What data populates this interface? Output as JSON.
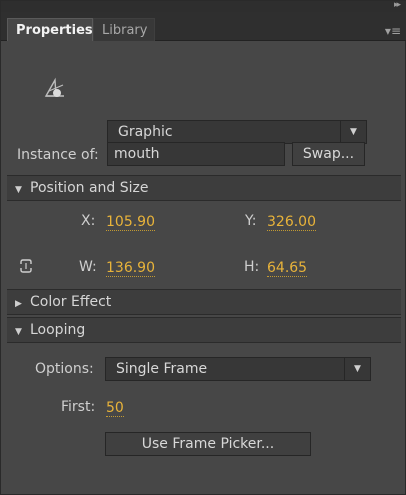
{
  "header": {
    "collapse_glyph": "▸▸",
    "tabs": [
      {
        "label": "Properties",
        "active": true
      },
      {
        "label": "Library",
        "active": false
      }
    ],
    "menu_glyph": "▾≡"
  },
  "instance": {
    "symbol_icon": "graphic-symbol-icon",
    "type_dropdown": {
      "value": "Graphic"
    },
    "instance_of_label": "Instance of:",
    "instance_of_value": "mouth",
    "swap_button": "Swap..."
  },
  "position_size": {
    "title": "Position and Size",
    "x_label": "X:",
    "x_value": "105.90",
    "y_label": "Y:",
    "y_value": "326.00",
    "w_label": "W:",
    "w_value": "136.90",
    "h_label": "H:",
    "h_value": "64.65",
    "link_icon": "chain-link-icon"
  },
  "color_effect": {
    "title": "Color Effect"
  },
  "looping": {
    "title": "Looping",
    "options_label": "Options:",
    "options_value": "Single Frame",
    "first_label": "First:",
    "first_value": "50",
    "frame_picker_button": "Use Frame Picker..."
  },
  "colors": {
    "value_accent": "#e8b33a",
    "panel_bg": "#474747"
  }
}
